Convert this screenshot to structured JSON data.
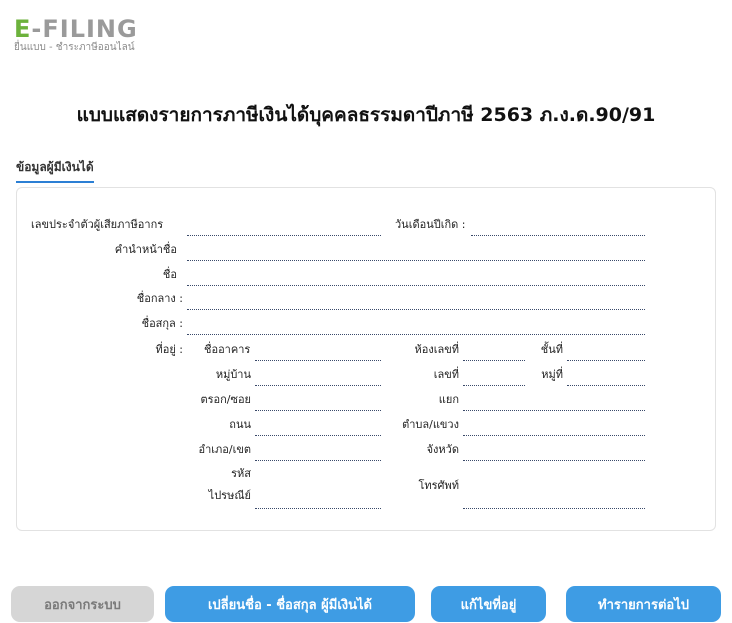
{
  "logo": {
    "prefix": "E",
    "rest": "-FILING",
    "subtitle": "ยื่นแบบ - ชำระภาษีออนไลน์"
  },
  "page_title": "แบบแสดงรายการภาษีเงินได้บุคคลธรรมดาปีภาษี 2563 ภ.ง.ด.90/91",
  "section_heading": "ข้อมูลผู้มีเงินได้",
  "form": {
    "tax_id_label": "เลขประจำตัวผู้เสียภาษีอากร",
    "birthdate_label": "วันเดือนปีเกิด :",
    "title_label": "คำนำหน้าชื่อ",
    "first_name_label": "ชื่อ",
    "middle_name_label": "ชื่อกลาง :",
    "last_name_label": "ชื่อสกุล :",
    "address_label": "ที่อยู่ :",
    "building_label": "ชื่ออาคาร",
    "room_label": "ห้องเลขที่",
    "floor_label": "ชั้นที่",
    "village_label": "หมู่บ้าน",
    "house_no_label": "เลขที่",
    "moo_label": "หมู่ที่",
    "soi_label": "ตรอก/ซอย",
    "junction_label": "แยก",
    "road_label": "ถนน",
    "subdistrict_label": "ตำบล/แขวง",
    "district_label": "อำเภอ/เขต",
    "province_label": "จังหวัด",
    "postcode_label_1": "รหัส",
    "postcode_label_2": "ไปรษณีย์",
    "phone_label": "โทรศัพท์"
  },
  "buttons": {
    "exit": "ออกจากระบบ",
    "change_name": "เปลี่ยนชื่อ - ชื่อสกุล ผู้มีเงินได้",
    "edit_address": "แก้ไขที่อยู่",
    "next": "ทำรายการต่อไป"
  },
  "colors": {
    "accent": "#3e9ce4",
    "logo_green": "#6cb23c",
    "disabled": "#d6d6d6"
  }
}
